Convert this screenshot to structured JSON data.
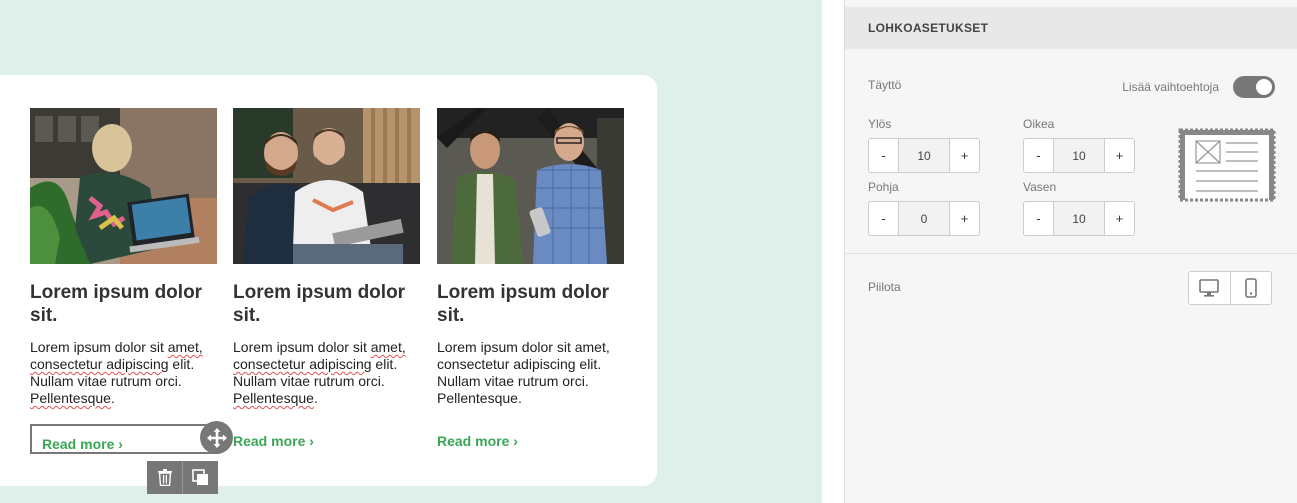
{
  "columns": [
    {
      "title": "Lorem ipsum dolor sit.",
      "body_pre": "Lorem ipsum dolor sit ",
      "body_sq1": "amet,",
      "body_sq2": "consectetur adipiscing",
      "body_mid": " elit. Nullam vitae rutrum orci. ",
      "body_sq3": "Pellentesque",
      "body_end": ".",
      "link": "Read more ›"
    },
    {
      "title": "Lorem ipsum dolor sit.",
      "body_pre": "Lorem ipsum dolor sit ",
      "body_sq1": "amet,",
      "body_sq2": "consectetur adipiscing",
      "body_mid": " elit. Nullam vitae rutrum orci. ",
      "body_sq3": "Pellentesque",
      "body_end": ".",
      "link": "Read more ›"
    },
    {
      "title": "Lorem ipsum dolor sit.",
      "body_pre": "Lorem ipsum dolor sit amet, consectetur adipiscing elit. Nullam vitae rutrum orci. Pellentesque.",
      "link": "Read more ›"
    }
  ],
  "panel": {
    "title": "LOHKOASETUKSET",
    "padding_label": "Täyttö",
    "more_options_label": "Lisää vaihtoehtoja",
    "more_options_on": true,
    "top_label": "Ylös",
    "top_value": "10",
    "right_label": "Oikea",
    "right_value": "10",
    "bottom_label": "Pohja",
    "bottom_value": "0",
    "left_label": "Vasen",
    "left_value": "10",
    "minus": "-",
    "plus": "+",
    "hide_label": "Piilota"
  },
  "icons": {
    "move": "move-icon",
    "delete": "trash-icon",
    "duplicate": "copy-icon",
    "desktop": "desktop-icon",
    "mobile": "mobile-icon"
  },
  "colors": {
    "accent_green": "#3aa655",
    "canvas_bg": "#dff0ea",
    "toggle": "#777777"
  }
}
